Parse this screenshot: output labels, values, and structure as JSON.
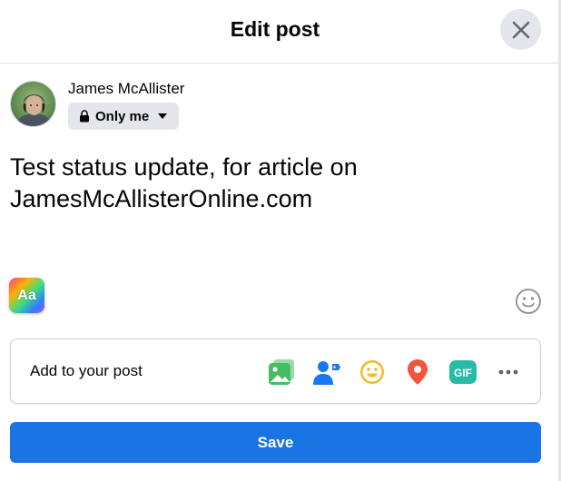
{
  "dialog": {
    "title": "Edit post",
    "close_icon": "close-icon"
  },
  "user": {
    "name": "James McAllister",
    "audience": "Only me",
    "audience_icon": "lock-icon"
  },
  "post": {
    "text": "Test status update, for article on JamesMcAllisterOnline.com"
  },
  "composer": {
    "text_format_label": "Aa",
    "emoji_icon": "smiley-icon"
  },
  "add_to_post": {
    "label": "Add to your post",
    "icons": [
      "photo-video-icon",
      "tag-people-icon",
      "feeling-icon",
      "location-icon",
      "gif-icon",
      "more-icon"
    ],
    "gif_label": "GIF"
  },
  "footer": {
    "save_label": "Save"
  },
  "colors": {
    "primary": "#1b74e4",
    "photo_green": "#45bd62",
    "tag_blue": "#1877f2",
    "feeling_yellow": "#f7b928",
    "location_red": "#f5533d",
    "gif_teal": "#2abba7"
  }
}
